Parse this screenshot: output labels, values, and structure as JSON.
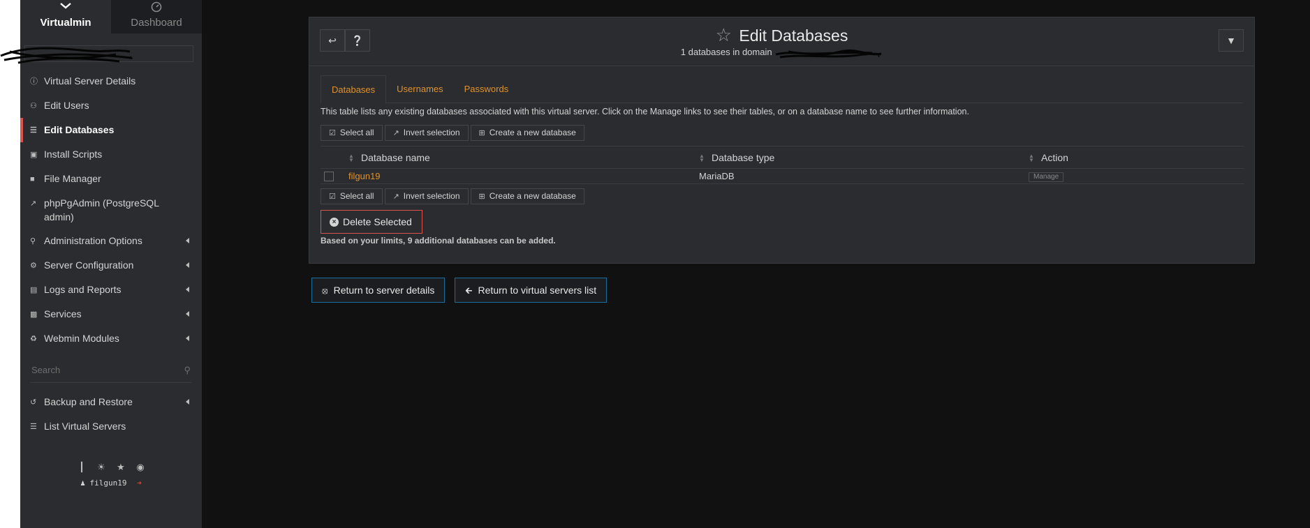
{
  "sidebar": {
    "tab_virtualmin": "Virtualmin",
    "tab_dashboard": "Dashboard",
    "items": [
      {
        "label": "Virtual Server Details",
        "icon": "info-circle-icon"
      },
      {
        "label": "Edit Users",
        "icon": "users-icon"
      },
      {
        "label": "Edit Databases",
        "icon": "database-icon",
        "active": true
      },
      {
        "label": "Install Scripts",
        "icon": "download-box-icon"
      },
      {
        "label": "File Manager",
        "icon": "folder-icon"
      },
      {
        "label": "phpPgAdmin (PostgreSQL admin)",
        "icon": "external-link-icon"
      },
      {
        "label": "Administration Options",
        "icon": "key-icon"
      },
      {
        "label": "Server Configuration",
        "icon": "cogs-icon"
      },
      {
        "label": "Logs and Reports",
        "icon": "file-text-icon"
      },
      {
        "label": "Services",
        "icon": "puzzle-icon"
      },
      {
        "label": "Webmin Modules",
        "icon": "recycle-icon"
      }
    ],
    "search_placeholder": "Search",
    "bottom_items": [
      {
        "label": "Backup and Restore",
        "icon": "history-icon"
      },
      {
        "label": "List Virtual Servers",
        "icon": "list-icon"
      }
    ],
    "username": "filgun19"
  },
  "panel": {
    "title": "Edit Databases",
    "subtitle": "1 databases in domain",
    "tabs": [
      "Databases",
      "Usernames",
      "Passwords"
    ],
    "description": "This table lists any existing databases associated with this virtual server. Click on the Manage links to see their tables, or on a database name to see further information.",
    "select_all": "Select all",
    "invert_selection": "Invert selection",
    "create_db": "Create a new database",
    "table": {
      "headers": [
        "Database name",
        "Database type",
        "Action"
      ],
      "rows": [
        {
          "name": "filgun19",
          "type": "MariaDB",
          "action": "Manage"
        }
      ]
    },
    "delete_label": "Delete Selected",
    "limits_text": "Based on your limits, 9 additional databases can be added."
  },
  "footer": {
    "return_server_details": "Return to server details",
    "return_servers_list": "Return to virtual servers list"
  },
  "colors": {
    "accent": "#e0922a",
    "danger": "#d9534f",
    "link_border": "#1a6ea0"
  }
}
